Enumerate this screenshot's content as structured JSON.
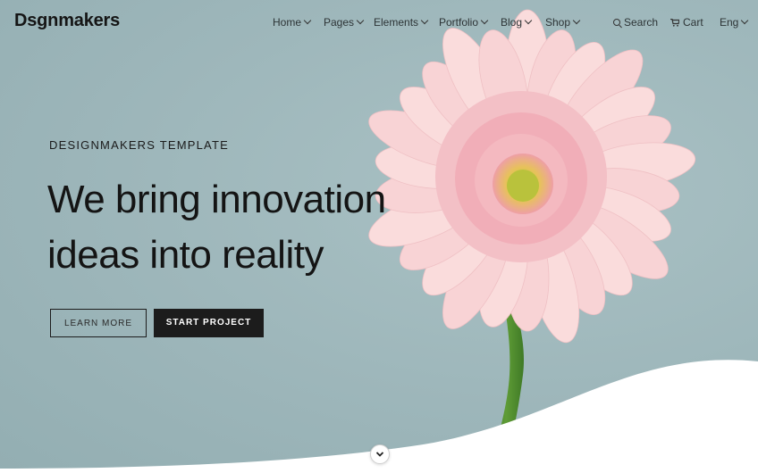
{
  "brand": {
    "logo": "Dsgnmakers"
  },
  "nav": {
    "items": [
      {
        "label": "Home"
      },
      {
        "label": "Pages"
      },
      {
        "label": "Elements"
      },
      {
        "label": "Portfolio"
      },
      {
        "label": "Blog"
      },
      {
        "label": "Shop"
      }
    ],
    "search_label": "Search",
    "cart_label": "Cart",
    "language_label": "Eng"
  },
  "hero": {
    "tagline": "DESIGNMAKERS TEMPLATE",
    "headline_line1": "We bring innovation",
    "headline_line2": "ideas into reality",
    "learn_more_label": "LEARN MORE",
    "start_project_label": "START PROJECT"
  },
  "colors": {
    "background": "#9db6ba",
    "text_dark": "#141414",
    "button_dark": "#1c1c1c",
    "petal": "#f6c9cd",
    "stem": "#4f8a2e"
  }
}
